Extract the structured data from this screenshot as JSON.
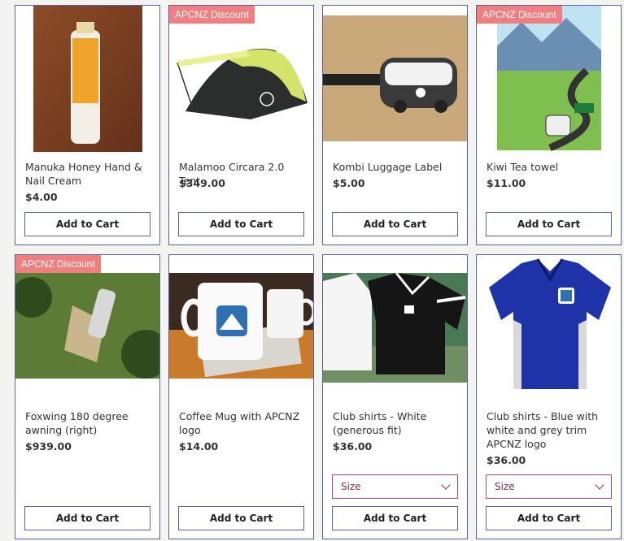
{
  "badge_text": "APCNZ Discount",
  "add_to_cart_label": "Add to Cart",
  "size_placeholder": "Size",
  "products": [
    {
      "title": "Manuka Honey Hand & Nail Cream",
      "price": "$4.00",
      "discount": false
    },
    {
      "title": "Malamoo Circara 2.0 Tent",
      "price": "$349.00",
      "discount": true
    },
    {
      "title": "Kombi Luggage Label",
      "price": "$5.00",
      "discount": false
    },
    {
      "title": "Kiwi Tea towel",
      "price": "$11.00",
      "discount": true
    },
    {
      "title": "Foxwing 180 degree awning (right)",
      "price": "$939.00",
      "discount": true
    },
    {
      "title": "Coffee Mug with APCNZ logo",
      "price": "$14.00",
      "discount": false
    },
    {
      "title": "Club shirts - White (generous fit)",
      "price": "$36.00",
      "discount": false,
      "has_size": true
    },
    {
      "title": "Club shirts - Blue with white and grey trim APCNZ logo",
      "price": "$36.00",
      "discount": false,
      "has_size": true
    }
  ],
  "colors": {
    "border": "#5b5fb0",
    "badge": "#f07f7f",
    "select_border": "#b04a6b"
  }
}
